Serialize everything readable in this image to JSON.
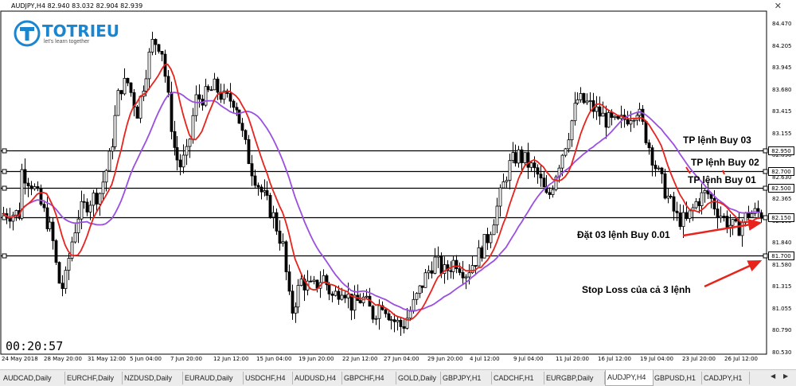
{
  "window": {
    "title": "AUDJPY,H4  82.940 83.032 82.904 82.939",
    "close": "✕"
  },
  "logo": {
    "name": "TOTRIEU",
    "tagline": "let's learn together"
  },
  "timer": "00:20:57",
  "price_axis": [
    "84.470",
    "84.205",
    "83.945",
    "83.680",
    "83.415",
    "83.155",
    "82.890",
    "82.630",
    "82.365",
    "82.105",
    "81.840",
    "81.580",
    "81.315",
    "81.055",
    "80.790",
    "80.530"
  ],
  "levels": [
    {
      "price": "82.950",
      "value": 82.95
    },
    {
      "price": "82.700",
      "value": 82.7
    },
    {
      "price": "82.500",
      "value": 82.5
    },
    {
      "price": "82.150",
      "value": 82.15
    },
    {
      "price": "81.700",
      "value": 81.7
    }
  ],
  "date_axis": [
    "24 May 2018",
    "28 May 20:00",
    "31 May 12:00",
    "5 Jun 04:00",
    "7 Jun 20:00",
    "12 Jun 12:00",
    "15 Jun 04:00",
    "19 Jun 20:00",
    "22 Jun 12:00",
    "27 Jun 04:00",
    "29 Jun 20:00",
    "4 Jul 12:00",
    "9 Jul 04:00",
    "11 Jul 20:00",
    "16 Jul 12:00",
    "19 Jul 04:00",
    "23 Jul 20:00",
    "26 Jul 12:00"
  ],
  "annotations": {
    "tp3": "TP lệnh Buy 03",
    "tp2": "TP lệnh Buy 02",
    "tp1": "TP lệnh Buy 01",
    "entry": "Đặt 03 lệnh Buy 0.01",
    "stoploss": "Stop Loss của cả 3 lệnh"
  },
  "tabs": [
    "AUDCAD,Daily",
    "EURCHF,Daily",
    "NZDUSD,Daily",
    "EURAUD,Daily",
    "USDCHF,H4",
    "AUDUSD,H4",
    "GBPCHF,H4",
    "GOLD,Daily",
    "GBPJPY,H1",
    "CADCHF,H1",
    "EURGBP,Daily",
    "AUDJPY,H4",
    "GBPUSD,H1",
    "CADJPY,H1"
  ],
  "active_tab": "AUDJPY,H4",
  "colors": {
    "fast_ma": "#e8231c",
    "slow_ma": "#9b4fe0",
    "candle": "#000000",
    "arrow": "#e8231c"
  },
  "chart_data": {
    "type": "candlestick",
    "symbol": "AUDJPY",
    "timeframe": "H4",
    "ylim": [
      80.53,
      84.6
    ],
    "shape": [
      [
        24,
        82.75
      ],
      [
        40,
        82.55
      ],
      [
        55,
        82.2
      ],
      [
        65,
        81.95
      ],
      [
        73,
        81.4
      ],
      [
        80,
        81.3
      ],
      [
        88,
        81.8
      ],
      [
        98,
        82.2
      ],
      [
        112,
        82.35
      ],
      [
        125,
        82.45
      ],
      [
        138,
        82.9
      ],
      [
        150,
        83.7
      ],
      [
        160,
        83.75
      ],
      [
        172,
        83.4
      ],
      [
        182,
        83.85
      ],
      [
        192,
        84.25
      ],
      [
        202,
        84.2
      ],
      [
        210,
        83.6
      ],
      [
        218,
        83.0
      ],
      [
        225,
        82.75
      ],
      [
        235,
        82.9
      ],
      [
        245,
        83.55
      ],
      [
        258,
        83.6
      ],
      [
        270,
        83.7
      ],
      [
        282,
        83.55
      ],
      [
        295,
        83.55
      ],
      [
        305,
        83.1
      ],
      [
        315,
        82.75
      ],
      [
        328,
        82.45
      ],
      [
        342,
        82.2
      ],
      [
        355,
        81.8
      ],
      [
        365,
        81.0
      ],
      [
        378,
        81.4
      ],
      [
        392,
        81.3
      ],
      [
        405,
        81.45
      ],
      [
        418,
        81.2
      ],
      [
        430,
        81.35
      ],
      [
        442,
        81.1
      ],
      [
        455,
        81.2
      ],
      [
        468,
        81.0
      ],
      [
        480,
        81.15
      ],
      [
        492,
        80.95
      ],
      [
        505,
        80.85
      ],
      [
        518,
        81.1
      ],
      [
        532,
        81.4
      ],
      [
        545,
        81.65
      ],
      [
        558,
        81.5
      ],
      [
        572,
        81.65
      ],
      [
        585,
        81.5
      ],
      [
        600,
        81.7
      ],
      [
        612,
        81.9
      ],
      [
        625,
        82.3
      ],
      [
        638,
        82.75
      ],
      [
        650,
        82.9
      ],
      [
        662,
        82.8
      ],
      [
        675,
        82.65
      ],
      [
        688,
        82.35
      ],
      [
        700,
        82.75
      ],
      [
        712,
        83.1
      ],
      [
        725,
        83.55
      ],
      [
        738,
        83.5
      ],
      [
        750,
        83.4
      ],
      [
        762,
        83.3
      ],
      [
        775,
        83.25
      ],
      [
        788,
        83.35
      ],
      [
        800,
        83.45
      ],
      [
        812,
        83.1
      ],
      [
        825,
        82.7
      ],
      [
        838,
        82.4
      ],
      [
        850,
        82.15
      ],
      [
        862,
        82.1
      ],
      [
        875,
        82.35
      ],
      [
        888,
        82.45
      ],
      [
        900,
        82.25
      ],
      [
        912,
        82.1
      ],
      [
        925,
        82.0
      ],
      [
        940,
        82.2
      ],
      [
        957,
        82.2
      ]
    ]
  }
}
